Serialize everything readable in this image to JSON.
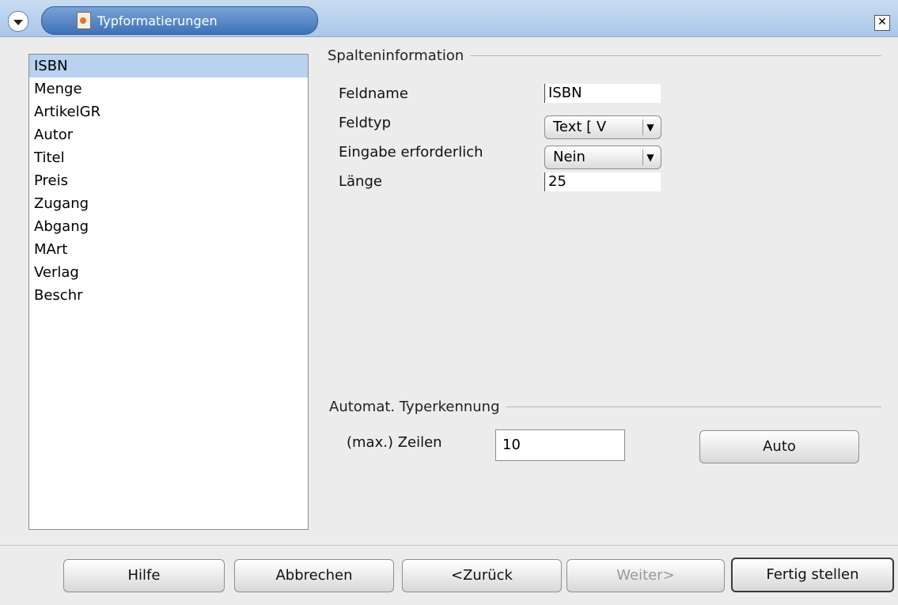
{
  "title": "Typformatierungen",
  "list_items": [
    "ISBN",
    "Menge",
    "ArtikelGR",
    "Autor",
    "Titel",
    "Preis",
    "Zugang",
    "Abgang",
    "MArt",
    "Verlag",
    "Beschr"
  ],
  "column_info": {
    "heading": "Spalteninformation",
    "fieldname_label": "Feldname",
    "fieldname_value": "ISBN",
    "fieldtype_label": "Feldtyp",
    "fieldtype_value": "Text [ V",
    "required_label": "Eingabe erforderlich",
    "required_value": "Nein",
    "length_label": "Länge",
    "length_value": "25"
  },
  "auto_type": {
    "heading": "Automat. Typerkennung",
    "rows_label": "(max.) Zeilen",
    "rows_value": "10",
    "auto_button": "Auto"
  },
  "buttons": {
    "help": "Hilfe",
    "cancel": "Abbrechen",
    "back": "<Zurück",
    "next": "Weiter>",
    "finish": "Fertig stellen"
  }
}
